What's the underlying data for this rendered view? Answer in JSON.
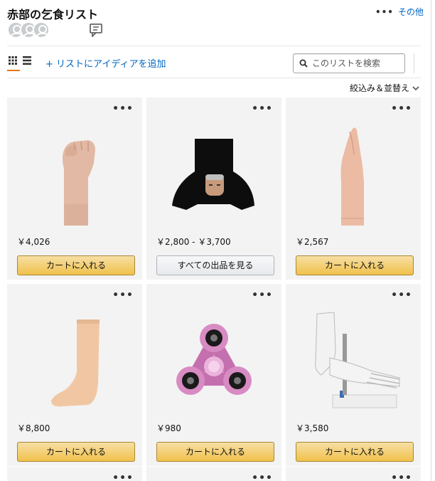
{
  "header": {
    "title": "赤部の乞食リスト",
    "more_label": "その他",
    "avatars": [
      "default-avatar-icon",
      "default-avatar-icon",
      "default-avatar-icon"
    ],
    "comment_icon": "comment-icon"
  },
  "toolbar": {
    "grid_view_icon": "grid-view-icon",
    "list_view_icon": "list-view-icon",
    "add_idea_label": "+ リストにアイディアを追加",
    "search_placeholder": "このリストを検索"
  },
  "filter_sort_label": "絞込み＆並替え",
  "items": [
    {
      "image": "clenched-fist-arm-model",
      "price": "￥4,026",
      "button_label": "カートに入れる",
      "button_type": "cart"
    },
    {
      "image": "black-costume-with-face",
      "price": "￥2,800 - ￥3,700",
      "button_label": "すべての出品を見る",
      "button_type": "offers"
    },
    {
      "image": "praying-hand-arm-model",
      "price": "￥2,567",
      "button_label": "カートに入れる",
      "button_type": "cart"
    },
    {
      "image": "foot-model",
      "price": "￥8,800",
      "button_label": "カートに入れる",
      "button_type": "cart"
    },
    {
      "image": "pink-fidget-spinner",
      "price": "￥980",
      "button_label": "カートに入れる",
      "button_type": "cart"
    },
    {
      "image": "foot-skeleton-model",
      "price": "￥3,580",
      "button_label": "カートに入れる",
      "button_type": "cart"
    }
  ],
  "colors": {
    "link": "#0066c0",
    "accent": "#e47911",
    "cart_button": "#f0c14b",
    "card_background": "#f3f3f3"
  }
}
